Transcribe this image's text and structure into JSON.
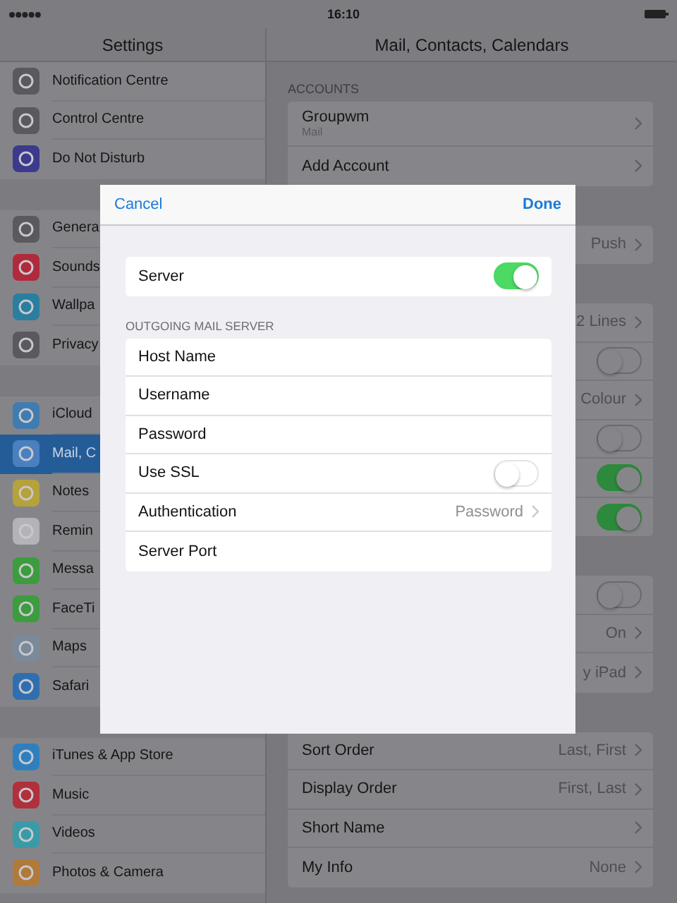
{
  "status_bar": {
    "time": "16:10"
  },
  "sidebar": {
    "title": "Settings",
    "groups": [
      [
        {
          "label": "Notification Centre",
          "selected": false,
          "color": "#5a5a5e"
        },
        {
          "label": "Control Centre",
          "selected": false,
          "color": "#5a5a5e"
        },
        {
          "label": "Do Not Disturb",
          "selected": false,
          "color": "#3b3a8c"
        }
      ],
      [
        {
          "label": "Genera",
          "selected": false,
          "color": "#5a5a5e"
        },
        {
          "label": "Sounds",
          "selected": false,
          "color": "#b02a3c"
        },
        {
          "label": "Wallpa",
          "selected": false,
          "color": "#2a7fa0"
        },
        {
          "label": "Privacy",
          "selected": false,
          "color": "#5a5a5e"
        }
      ],
      [
        {
          "label": "iCloud",
          "selected": false,
          "color": "#3f7cb0"
        },
        {
          "label": "Mail, C",
          "selected": true,
          "color": "#4a80c0"
        },
        {
          "label": "Notes",
          "selected": false,
          "color": "#b5a23a"
        },
        {
          "label": "Remin",
          "selected": false,
          "color": "#b4b4b8"
        },
        {
          "label": "Messa",
          "selected": false,
          "color": "#3c9c3e"
        },
        {
          "label": "FaceTi",
          "selected": false,
          "color": "#3c9c3e"
        },
        {
          "label": "Maps",
          "selected": false,
          "color": "#7a8a9a"
        },
        {
          "label": "Safari",
          "selected": false,
          "color": "#2f6fb0"
        }
      ],
      [
        {
          "label": "iTunes & App Store",
          "selected": false,
          "color": "#2f7fc0"
        },
        {
          "label": "Music",
          "selected": false,
          "color": "#b0303c"
        },
        {
          "label": "Videos",
          "selected": false,
          "color": "#3a9aa8"
        },
        {
          "label": "Photos & Camera",
          "selected": false,
          "color": "#b07a3a"
        }
      ]
    ]
  },
  "detail": {
    "title": "Mail, Contacts, Calendars",
    "sections": [
      {
        "header": "ACCOUNTS",
        "rows": [
          {
            "kind": "link",
            "label": "Groupwm",
            "sublabel": "Mail"
          },
          {
            "kind": "link",
            "label": "Add Account"
          }
        ]
      },
      {
        "rows": [
          {
            "kind": "link",
            "value": "Push"
          }
        ]
      },
      {
        "rows": [
          {
            "kind": "link",
            "value": "2 Lines"
          },
          {
            "kind": "toggle",
            "on": false
          },
          {
            "kind": "link",
            "value": "Colour"
          },
          {
            "kind": "toggle",
            "on": false
          },
          {
            "kind": "toggle",
            "on": true
          },
          {
            "kind": "toggle",
            "on": true
          }
        ]
      },
      {
        "rows": [
          {
            "kind": "toggle",
            "on": false
          },
          {
            "kind": "link",
            "value": "On"
          },
          {
            "kind": "link",
            "value": "y iPad"
          }
        ]
      },
      {
        "rows": [
          {
            "kind": "link",
            "label": "Sort Order",
            "value": "Last, First"
          },
          {
            "kind": "link",
            "label": "Display Order",
            "value": "First, Last"
          },
          {
            "kind": "link",
            "label": "Short Name"
          },
          {
            "kind": "link",
            "label": "My Info",
            "value": "None"
          }
        ]
      }
    ]
  },
  "modal": {
    "cancel": "Cancel",
    "done": "Done",
    "sections": [
      {
        "rows": [
          {
            "kind": "toggle",
            "label": "Server",
            "on": true
          }
        ]
      },
      {
        "header": "OUTGOING MAIL SERVER",
        "rows": [
          {
            "kind": "field",
            "label": "Host Name"
          },
          {
            "kind": "field",
            "label": "Username"
          },
          {
            "kind": "field",
            "label": "Password"
          },
          {
            "kind": "toggle",
            "label": "Use SSL",
            "on": false
          },
          {
            "kind": "link",
            "label": "Authentication",
            "value": "Password"
          },
          {
            "kind": "field",
            "label": "Server Port"
          }
        ]
      }
    ]
  }
}
